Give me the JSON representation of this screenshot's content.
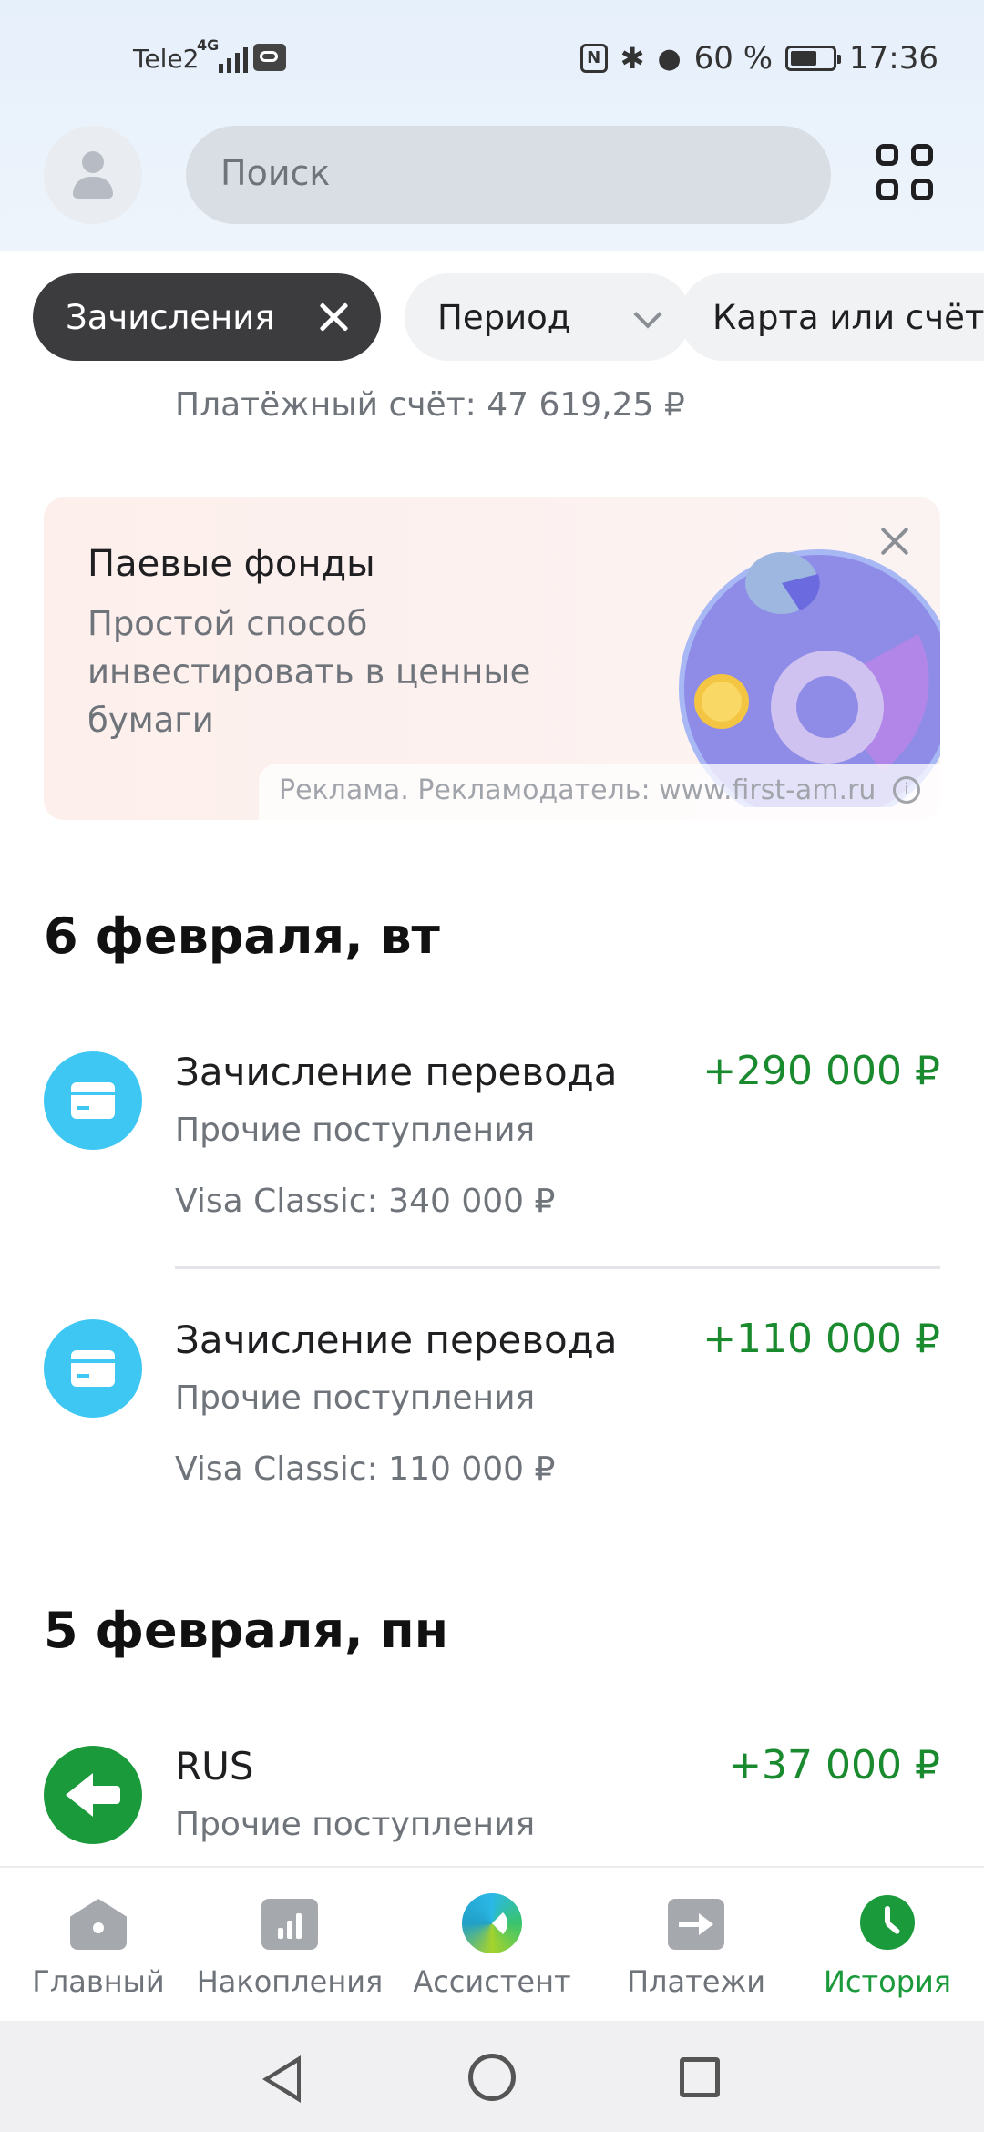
{
  "status_bar": {
    "carrier": "Tele2",
    "network": "4G",
    "nfc": "N",
    "battery_percent": "60 %",
    "time": "17:36"
  },
  "header": {
    "search_placeholder": "Поиск"
  },
  "filters": {
    "active_chip": "Зачисления",
    "period_chip": "Период",
    "account_chip": "Карта или счёт"
  },
  "balance_line": "Платёжный счёт: 47 619,25 ₽",
  "promo": {
    "title": "Паевые фонды",
    "text": "Простой способ инвестировать в ценные бумаги",
    "ad_note": "Реклама. Рекламодатель: www.first-am.ru",
    "info_glyph": "i"
  },
  "history": [
    {
      "date": "6 февраля, вт",
      "items": [
        {
          "title": "Зачисление перевода",
          "amount": "+290 000 ₽",
          "category": "Прочие поступления",
          "card": "Visa Classic: 340 000 ₽",
          "icon": "card-icon"
        },
        {
          "title": "Зачисление перевода",
          "amount": "+110 000 ₽",
          "category": "Прочие поступления",
          "card": "Visa Classic: 110 000 ₽",
          "icon": "card-icon"
        }
      ]
    },
    {
      "date": "5 февраля, пн",
      "items": [
        {
          "title": "RUS",
          "amount": "+37 000 ₽",
          "category": "Прочие поступления",
          "icon": "arrow-left-icon"
        }
      ]
    }
  ],
  "bottom_nav": [
    {
      "label": "Главный",
      "icon": "home-icon",
      "active": false
    },
    {
      "label": "Накопления",
      "icon": "savings-icon",
      "active": false
    },
    {
      "label": "Ассистент",
      "icon": "assistant-icon",
      "active": false
    },
    {
      "label": "Платежи",
      "icon": "payments-icon",
      "active": false
    },
    {
      "label": "История",
      "icon": "history-icon",
      "active": true
    }
  ],
  "colors": {
    "accent_green": "#1a9a3a",
    "income_green": "#1a8a2e",
    "icon_blue": "#3fc7f3",
    "chip_dark": "#3c3c3f"
  }
}
